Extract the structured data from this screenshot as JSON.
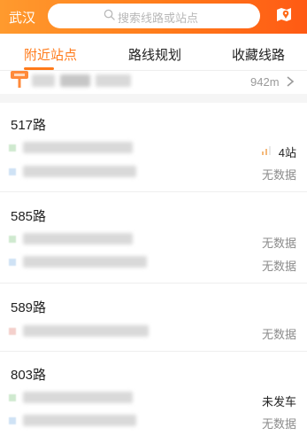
{
  "header": {
    "city": "武汉",
    "search_placeholder": "搜索线路或站点",
    "search_icon": "search-icon",
    "map_icon": "map-pin-icon",
    "accent_color": "#ff7a1a"
  },
  "tabs": [
    {
      "label": "附近站点",
      "active": true
    },
    {
      "label": "路线规划",
      "active": false
    },
    {
      "label": "收藏线路",
      "active": false
    }
  ],
  "nearby_station": {
    "distance": "942m",
    "icon": "bus-stop-icon"
  },
  "routes": [
    {
      "name": "517路",
      "directions": [
        {
          "status": "4站",
          "status_icon": "signal-icon"
        },
        {
          "status": "无数据"
        }
      ]
    },
    {
      "name": "585路",
      "directions": [
        {
          "status": "无数据"
        },
        {
          "status": "无数据"
        }
      ]
    },
    {
      "name": "589路",
      "directions": [
        {
          "status": "无数据"
        }
      ]
    },
    {
      "name": "803路",
      "directions": [
        {
          "status": "未发车"
        },
        {
          "status": "无数据"
        }
      ]
    }
  ]
}
